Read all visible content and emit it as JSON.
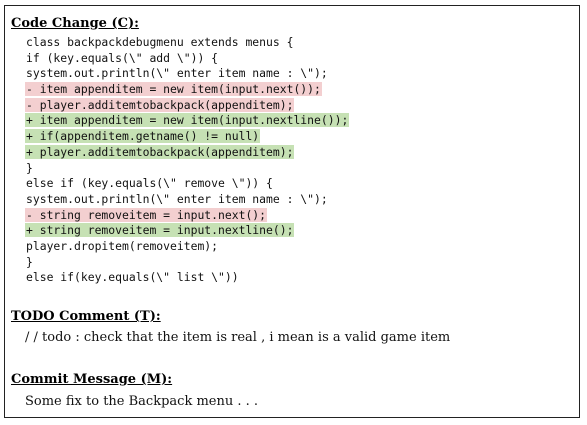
{
  "code_change": {
    "heading": "Code Change (C):",
    "lines": [
      {
        "type": "ctx",
        "text": "class backpackdebugmenu extends menus {"
      },
      {
        "type": "ctx",
        "text": "if (key.equals(\\\" add \\\")) {"
      },
      {
        "type": "ctx",
        "text": "system.out.println(\\\" enter item name : \\\");"
      },
      {
        "type": "del",
        "text": "- item appenditem = new item(input.next());"
      },
      {
        "type": "del",
        "text": "- player.additemtobackpack(appenditem);"
      },
      {
        "type": "add",
        "text": "+ item appenditem = new item(input.nextline());"
      },
      {
        "type": "add",
        "text": "+ if(appenditem.getname() != null)"
      },
      {
        "type": "add",
        "text": "+ player.additemtobackpack(appenditem);"
      },
      {
        "type": "ctx",
        "text": "}"
      },
      {
        "type": "ctx",
        "text": "else if (key.equals(\\\" remove \\\")) {"
      },
      {
        "type": "ctx",
        "text": "system.out.println(\\\" enter item name : \\\");"
      },
      {
        "type": "del",
        "text": "- string removeitem = input.next();"
      },
      {
        "type": "add",
        "text": "+ string removeitem = input.nextline();"
      },
      {
        "type": "ctx",
        "text": "player.dropitem(removeitem);"
      },
      {
        "type": "ctx",
        "text": "}"
      },
      {
        "type": "ctx",
        "text": "else if(key.equals(\\\" list \\\"))"
      }
    ]
  },
  "todo_comment": {
    "heading": "TODO Comment (T):",
    "text": "/ / todo : check that the item is real , i mean is a valid game item"
  },
  "commit_message": {
    "heading": "Commit Message (M):",
    "text": "Some fix to the Backpack menu . . ."
  },
  "colors": {
    "deleted_line_bg": "#f3cfd0",
    "added_line_bg": "#c6e1b4"
  }
}
